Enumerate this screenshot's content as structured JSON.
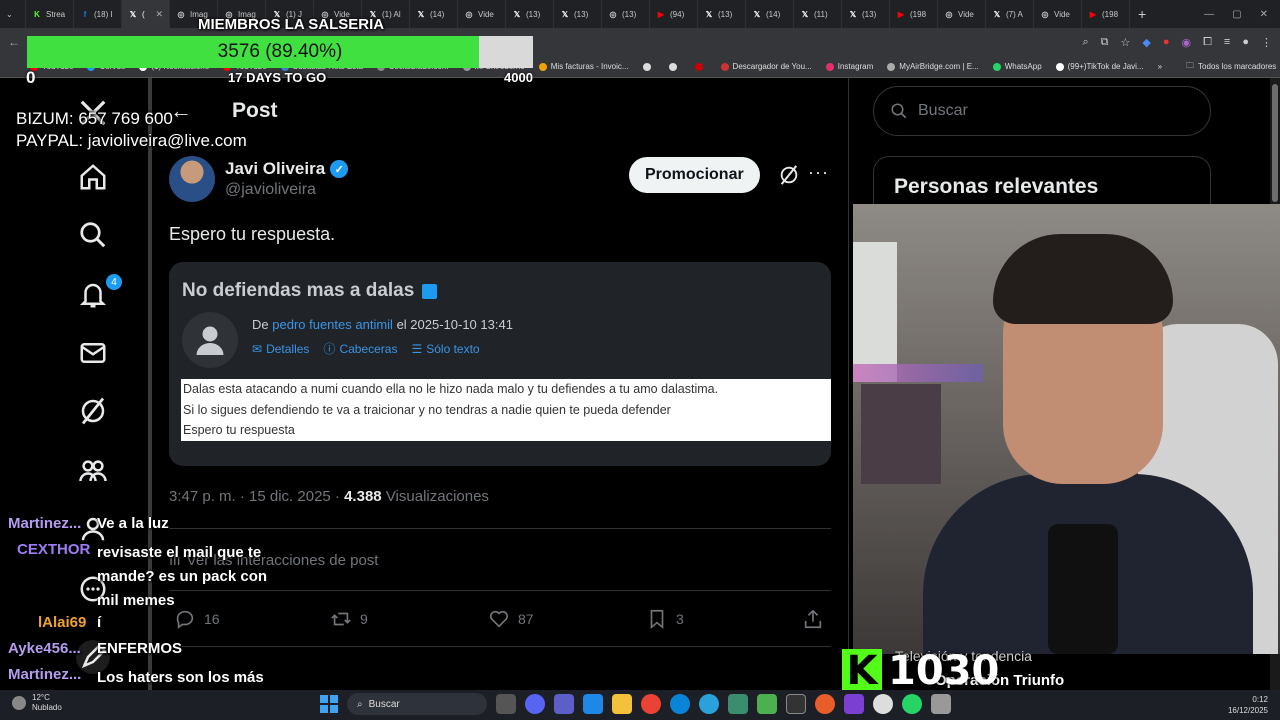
{
  "browser": {
    "tabs": [
      {
        "label": "Strea",
        "icon": "kick-icon",
        "color": "#53fc18"
      },
      {
        "label": "(18) I",
        "icon": "facebook-icon",
        "color": "#1877f2"
      },
      {
        "label": "(",
        "icon": "x-icon",
        "color": "#ffffff",
        "active": true
      },
      {
        "label": "Imag",
        "icon": "globe-icon",
        "color": "#cccccc"
      },
      {
        "label": "Imag",
        "icon": "globe-icon",
        "color": "#cccccc"
      },
      {
        "label": "(1) J",
        "icon": "x-icon",
        "color": "#ffffff"
      },
      {
        "label": "Vide",
        "icon": "globe-icon",
        "color": "#cccccc"
      },
      {
        "label": "(1) Al",
        "icon": "x-icon",
        "color": "#ffffff"
      },
      {
        "label": "(14)",
        "icon": "x-icon",
        "color": "#ffffff"
      },
      {
        "label": "Vide",
        "icon": "globe-icon",
        "color": "#cccccc"
      },
      {
        "label": "(13)",
        "icon": "x-icon",
        "color": "#ffffff"
      },
      {
        "label": "(13)",
        "icon": "x-icon",
        "color": "#ffffff"
      },
      {
        "label": "(13)",
        "icon": "globe-icon",
        "color": "#cccccc"
      },
      {
        "label": "(94)",
        "icon": "youtube-icon",
        "color": "#ff0000"
      },
      {
        "label": "(13)",
        "icon": "x-icon",
        "color": "#ffffff"
      },
      {
        "label": "(14)",
        "icon": "x-icon",
        "color": "#ffffff"
      },
      {
        "label": "(11)",
        "icon": "x-icon",
        "color": "#ffffff"
      },
      {
        "label": "(13)",
        "icon": "x-icon",
        "color": "#ffffff"
      },
      {
        "label": "(198",
        "icon": "youtube-icon",
        "color": "#ff0000"
      },
      {
        "label": "Vide",
        "icon": "globe-icon",
        "color": "#cccccc"
      },
      {
        "label": "(7) A",
        "icon": "x-icon",
        "color": "#ffffff"
      },
      {
        "label": "Vide",
        "icon": "globe-icon",
        "color": "#cccccc"
      },
      {
        "label": "(198",
        "icon": "youtube-icon",
        "color": "#ff0000"
      }
    ],
    "new_tab": "+",
    "bookmarks": [
      {
        "label": "YouTube",
        "color": "#ff0000"
      },
      {
        "label": "ColVue",
        "color": "#1d9bf0"
      },
      {
        "label": "(1) Notificacione",
        "color": "#ffffff"
      },
      {
        "label": "YouTube",
        "color": "#ff0000"
      },
      {
        "label": "Subastas Real Esta",
        "color": "#3a7bd5"
      },
      {
        "label": "SocialBlade.com",
        "color": "#888888"
      },
      {
        "label": "Mi Chiroderno",
        "color": "#999999"
      },
      {
        "label": "Mis facturas - Invoic...",
        "color": "#f0a000"
      },
      {
        "label": "",
        "color": "#dddddd"
      },
      {
        "label": "",
        "color": "#dddddd"
      },
      {
        "label": "",
        "color": "#cc0000"
      },
      {
        "label": "Descargador de You...",
        "color": "#cc3333"
      },
      {
        "label": "Instagram",
        "color": "#e1306c"
      },
      {
        "label": "MyAirBridge.com | E...",
        "color": "#aaaaaa"
      },
      {
        "label": "WhatsApp",
        "color": "#25d366"
      },
      {
        "label": "(99+)TikTok de Javi...",
        "color": "#ffffff"
      }
    ],
    "bookmarks_more": "»",
    "all_bookmarks": "Todos los marcadores"
  },
  "overlay": {
    "title": "MIEMBROS LA SALSERIA",
    "goal_text": "3576 (89.40%)",
    "goal_fraction": 0.894,
    "goal_min": "0",
    "goal_max": "4000",
    "days_left": "17 DAYS TO GO",
    "payment_lines": [
      "BIZUM: 657 769 600",
      "PAYPAL: javioliveira@live.com"
    ],
    "bar_color": "#3fe03f"
  },
  "x": {
    "header_title": "Post",
    "nav": [
      {
        "name": "home-icon"
      },
      {
        "name": "search-icon"
      },
      {
        "name": "notifications-icon",
        "badge": "4"
      },
      {
        "name": "messages-icon"
      },
      {
        "name": "grok-icon"
      },
      {
        "name": "communities-icon"
      },
      {
        "name": "profile-icon"
      },
      {
        "name": "more-icon"
      }
    ],
    "author": {
      "name": "Javi Oliveira",
      "handle": "@javioliveira"
    },
    "promote_label": "Promocionar",
    "post_text": "Espero tu respuesta.",
    "email": {
      "subject": "No defiendas mas a dalas",
      "from_prefix": "De",
      "from_name": "pedro fuentes antimil",
      "from_date": "el 2025-10-10 13:41",
      "links": [
        "Detalles",
        "Cabeceras",
        "Sólo texto"
      ],
      "body_lines": [
        "Dalas esta atacando a numi cuando ella no le hizo nada malo y tu defiendes a tu amo dalastima.",
        "Si lo sigues defendiendo te va a traicionar y no tendras a nadie quien te pueda defender",
        "Espero tu respuesta"
      ]
    },
    "timestamp": "3:47 p. m. · 15 dic. 2025 · ",
    "views_count": "4.388",
    "views_label": "Visualizaciones",
    "interactions": "Ver las interacciones de post",
    "actions": {
      "replies": "16",
      "reposts": "9",
      "likes": "87",
      "bookmarks": "3"
    },
    "search_placeholder": "Buscar",
    "relevant_title": "Personas relevantes"
  },
  "chat": [
    {
      "user": "Martinez...",
      "msg": "Ve a la luz",
      "color": "#b59cf0"
    },
    {
      "user": "CEXTHOR",
      "msg": "revisaste el mail que te mande? es un pack con mil memes",
      "color": "#9f7cf5"
    },
    {
      "user": "lAlai69",
      "msg": "í",
      "color": "#f0a030"
    },
    {
      "user": "Ayke456...",
      "msg": "ENFERMOS",
      "color": "#b59cf0"
    },
    {
      "user": "Martinez...",
      "msg": "Los haters son los más fans",
      "color": "#b59cf0"
    }
  ],
  "kick": {
    "logo": "K",
    "count": "1030",
    "under1": "Televisión y tendencia",
    "under2": "Operación Triunfo"
  },
  "taskbar": {
    "weather_temp": "12°C",
    "weather_desc": "Nublado",
    "search_label": "Buscar",
    "time": "0:12",
    "date": "16/12/2025"
  }
}
